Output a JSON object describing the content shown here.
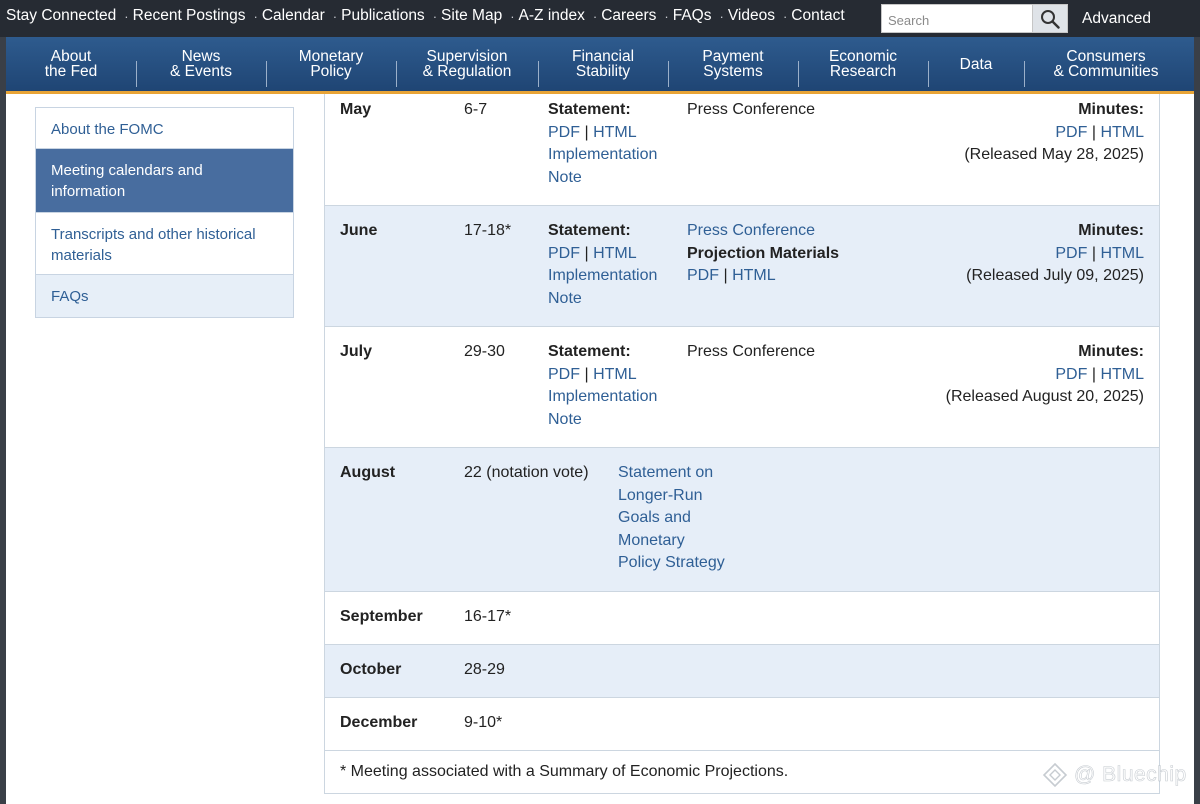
{
  "utility_bar": {
    "links": [
      "Stay Connected",
      "Recent Postings",
      "Calendar",
      "Publications",
      "Site Map",
      "A-Z index",
      "Careers",
      "FAQs",
      "Videos",
      "Contact"
    ],
    "search_placeholder": "Search",
    "advanced_label": "Advanced"
  },
  "main_nav": {
    "items": [
      {
        "line1": "About",
        "line2": "the Fed"
      },
      {
        "line1": "News",
        "line2": "& Events"
      },
      {
        "line1": "Monetary",
        "line2": "Policy"
      },
      {
        "line1": "Supervision",
        "line2": "& Regulation"
      },
      {
        "line1": "Financial",
        "line2": "Stability"
      },
      {
        "line1": "Payment",
        "line2": "Systems"
      },
      {
        "line1": "Economic",
        "line2": "Research"
      },
      {
        "line1": "Data",
        "line2": ""
      },
      {
        "line1": "Consumers",
        "line2": "& Communities"
      }
    ]
  },
  "sidebar": {
    "items": [
      {
        "label": "About the FOMC"
      },
      {
        "label": "Meeting calendars and information",
        "selected": true
      },
      {
        "label": "Transcripts and other historical materials"
      },
      {
        "label": "FAQs"
      }
    ]
  },
  "calendar": {
    "statement_label": "Statement:",
    "pdf": "PDF",
    "html": "HTML",
    "pipe": "|",
    "implementation": "Implementation",
    "note": "Note",
    "press_conference": "Press Conference",
    "projection_materials": "Projection Materials",
    "minutes_label": "Minutes:",
    "rows": [
      {
        "month": "May",
        "dates": "6-7",
        "released": "(Released May 28, 2025)"
      },
      {
        "month": "June",
        "dates": "17-18*",
        "released": "(Released July 09, 2025)"
      },
      {
        "month": "July",
        "dates": "29-30",
        "released": "(Released August 20, 2025)"
      },
      {
        "month": "August",
        "dates": "22 (notation vote)",
        "statement_lines": [
          "Statement on",
          "Longer-Run",
          "Goals and",
          "Monetary",
          "Policy Strategy"
        ]
      },
      {
        "month": "September",
        "dates": "16-17*"
      },
      {
        "month": "October",
        "dates": "28-29"
      },
      {
        "month": "December",
        "dates": "9-10*"
      }
    ],
    "footnote": "* Meeting associated with a Summary of Economic Projections."
  },
  "watermark": {
    "text": "@ Bluechip"
  },
  "colors": {
    "link": "#2f5f95",
    "nav": "#1f4574",
    "accent": "#e8a436",
    "alt_row": "#e6eef8"
  }
}
